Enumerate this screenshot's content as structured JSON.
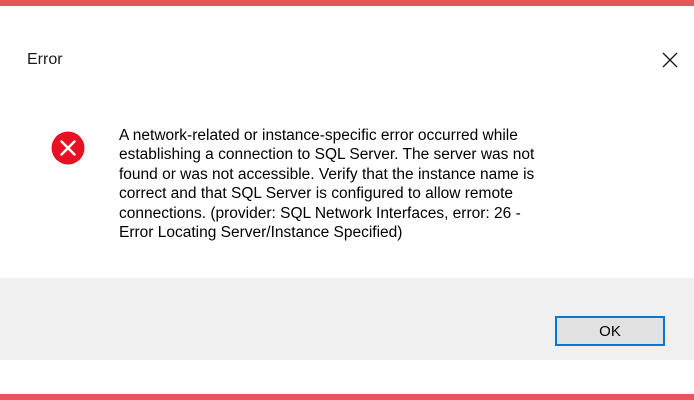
{
  "colors": {
    "accent_bar": "#e9555a",
    "error_icon": "#e81123",
    "button_border": "#0078d7",
    "footer_bg": "#f0f0f0"
  },
  "dialog": {
    "title": "Error",
    "close_icon": "close-icon",
    "error_icon": "error-x-icon",
    "message_lines": [
      "A network-related or instance-specific error occurred while",
      "establishing a connection to SQL Server. The server was not",
      "found or was not accessible. Verify that the instance name is",
      "correct and that SQL Server is configured to allow remote",
      "connections. (provider: SQL Network Interfaces, error: 26 -",
      "Error Locating Server/Instance Specified)"
    ],
    "ok_label": "OK"
  }
}
